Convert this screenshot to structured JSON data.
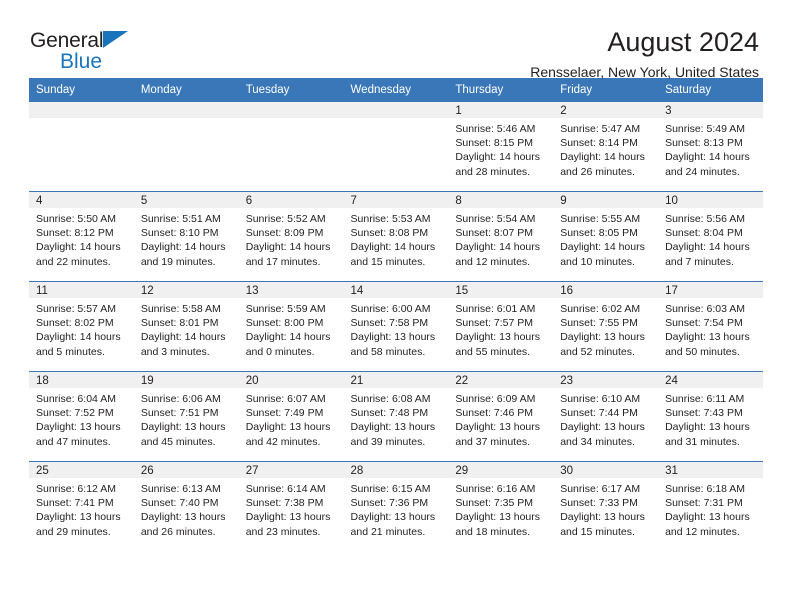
{
  "brand": {
    "name_top": "General",
    "name_bottom": "Blue",
    "accent_color": "#1a74bb"
  },
  "header": {
    "title": "August 2024",
    "subtitle": "Rensselaer, New York, United States"
  },
  "theme": {
    "header_row_bg": "#3a77b8",
    "daynum_bg": "#f0f0f0",
    "text_color": "#231f20"
  },
  "weekdays": [
    "Sunday",
    "Monday",
    "Tuesday",
    "Wednesday",
    "Thursday",
    "Friday",
    "Saturday"
  ],
  "labels": {
    "sunrise": "Sunrise:",
    "sunset": "Sunset:",
    "daylight": "Daylight:"
  },
  "weeks": [
    [
      {
        "day": "",
        "empty": true
      },
      {
        "day": "",
        "empty": true
      },
      {
        "day": "",
        "empty": true
      },
      {
        "day": "",
        "empty": true
      },
      {
        "day": "1",
        "sunrise": "Sunrise: 5:46 AM",
        "sunset": "Sunset: 8:15 PM",
        "daylight1": "Daylight: 14 hours",
        "daylight2": "and 28 minutes."
      },
      {
        "day": "2",
        "sunrise": "Sunrise: 5:47 AM",
        "sunset": "Sunset: 8:14 PM",
        "daylight1": "Daylight: 14 hours",
        "daylight2": "and 26 minutes."
      },
      {
        "day": "3",
        "sunrise": "Sunrise: 5:49 AM",
        "sunset": "Sunset: 8:13 PM",
        "daylight1": "Daylight: 14 hours",
        "daylight2": "and 24 minutes."
      }
    ],
    [
      {
        "day": "4",
        "sunrise": "Sunrise: 5:50 AM",
        "sunset": "Sunset: 8:12 PM",
        "daylight1": "Daylight: 14 hours",
        "daylight2": "and 22 minutes."
      },
      {
        "day": "5",
        "sunrise": "Sunrise: 5:51 AM",
        "sunset": "Sunset: 8:10 PM",
        "daylight1": "Daylight: 14 hours",
        "daylight2": "and 19 minutes."
      },
      {
        "day": "6",
        "sunrise": "Sunrise: 5:52 AM",
        "sunset": "Sunset: 8:09 PM",
        "daylight1": "Daylight: 14 hours",
        "daylight2": "and 17 minutes."
      },
      {
        "day": "7",
        "sunrise": "Sunrise: 5:53 AM",
        "sunset": "Sunset: 8:08 PM",
        "daylight1": "Daylight: 14 hours",
        "daylight2": "and 15 minutes."
      },
      {
        "day": "8",
        "sunrise": "Sunrise: 5:54 AM",
        "sunset": "Sunset: 8:07 PM",
        "daylight1": "Daylight: 14 hours",
        "daylight2": "and 12 minutes."
      },
      {
        "day": "9",
        "sunrise": "Sunrise: 5:55 AM",
        "sunset": "Sunset: 8:05 PM",
        "daylight1": "Daylight: 14 hours",
        "daylight2": "and 10 minutes."
      },
      {
        "day": "10",
        "sunrise": "Sunrise: 5:56 AM",
        "sunset": "Sunset: 8:04 PM",
        "daylight1": "Daylight: 14 hours",
        "daylight2": "and 7 minutes."
      }
    ],
    [
      {
        "day": "11",
        "sunrise": "Sunrise: 5:57 AM",
        "sunset": "Sunset: 8:02 PM",
        "daylight1": "Daylight: 14 hours",
        "daylight2": "and 5 minutes."
      },
      {
        "day": "12",
        "sunrise": "Sunrise: 5:58 AM",
        "sunset": "Sunset: 8:01 PM",
        "daylight1": "Daylight: 14 hours",
        "daylight2": "and 3 minutes."
      },
      {
        "day": "13",
        "sunrise": "Sunrise: 5:59 AM",
        "sunset": "Sunset: 8:00 PM",
        "daylight1": "Daylight: 14 hours",
        "daylight2": "and 0 minutes."
      },
      {
        "day": "14",
        "sunrise": "Sunrise: 6:00 AM",
        "sunset": "Sunset: 7:58 PM",
        "daylight1": "Daylight: 13 hours",
        "daylight2": "and 58 minutes."
      },
      {
        "day": "15",
        "sunrise": "Sunrise: 6:01 AM",
        "sunset": "Sunset: 7:57 PM",
        "daylight1": "Daylight: 13 hours",
        "daylight2": "and 55 minutes."
      },
      {
        "day": "16",
        "sunrise": "Sunrise: 6:02 AM",
        "sunset": "Sunset: 7:55 PM",
        "daylight1": "Daylight: 13 hours",
        "daylight2": "and 52 minutes."
      },
      {
        "day": "17",
        "sunrise": "Sunrise: 6:03 AM",
        "sunset": "Sunset: 7:54 PM",
        "daylight1": "Daylight: 13 hours",
        "daylight2": "and 50 minutes."
      }
    ],
    [
      {
        "day": "18",
        "sunrise": "Sunrise: 6:04 AM",
        "sunset": "Sunset: 7:52 PM",
        "daylight1": "Daylight: 13 hours",
        "daylight2": "and 47 minutes."
      },
      {
        "day": "19",
        "sunrise": "Sunrise: 6:06 AM",
        "sunset": "Sunset: 7:51 PM",
        "daylight1": "Daylight: 13 hours",
        "daylight2": "and 45 minutes."
      },
      {
        "day": "20",
        "sunrise": "Sunrise: 6:07 AM",
        "sunset": "Sunset: 7:49 PM",
        "daylight1": "Daylight: 13 hours",
        "daylight2": "and 42 minutes."
      },
      {
        "day": "21",
        "sunrise": "Sunrise: 6:08 AM",
        "sunset": "Sunset: 7:48 PM",
        "daylight1": "Daylight: 13 hours",
        "daylight2": "and 39 minutes."
      },
      {
        "day": "22",
        "sunrise": "Sunrise: 6:09 AM",
        "sunset": "Sunset: 7:46 PM",
        "daylight1": "Daylight: 13 hours",
        "daylight2": "and 37 minutes."
      },
      {
        "day": "23",
        "sunrise": "Sunrise: 6:10 AM",
        "sunset": "Sunset: 7:44 PM",
        "daylight1": "Daylight: 13 hours",
        "daylight2": "and 34 minutes."
      },
      {
        "day": "24",
        "sunrise": "Sunrise: 6:11 AM",
        "sunset": "Sunset: 7:43 PM",
        "daylight1": "Daylight: 13 hours",
        "daylight2": "and 31 minutes."
      }
    ],
    [
      {
        "day": "25",
        "sunrise": "Sunrise: 6:12 AM",
        "sunset": "Sunset: 7:41 PM",
        "daylight1": "Daylight: 13 hours",
        "daylight2": "and 29 minutes."
      },
      {
        "day": "26",
        "sunrise": "Sunrise: 6:13 AM",
        "sunset": "Sunset: 7:40 PM",
        "daylight1": "Daylight: 13 hours",
        "daylight2": "and 26 minutes."
      },
      {
        "day": "27",
        "sunrise": "Sunrise: 6:14 AM",
        "sunset": "Sunset: 7:38 PM",
        "daylight1": "Daylight: 13 hours",
        "daylight2": "and 23 minutes."
      },
      {
        "day": "28",
        "sunrise": "Sunrise: 6:15 AM",
        "sunset": "Sunset: 7:36 PM",
        "daylight1": "Daylight: 13 hours",
        "daylight2": "and 21 minutes."
      },
      {
        "day": "29",
        "sunrise": "Sunrise: 6:16 AM",
        "sunset": "Sunset: 7:35 PM",
        "daylight1": "Daylight: 13 hours",
        "daylight2": "and 18 minutes."
      },
      {
        "day": "30",
        "sunrise": "Sunrise: 6:17 AM",
        "sunset": "Sunset: 7:33 PM",
        "daylight1": "Daylight: 13 hours",
        "daylight2": "and 15 minutes."
      },
      {
        "day": "31",
        "sunrise": "Sunrise: 6:18 AM",
        "sunset": "Sunset: 7:31 PM",
        "daylight1": "Daylight: 13 hours",
        "daylight2": "and 12 minutes."
      }
    ]
  ]
}
